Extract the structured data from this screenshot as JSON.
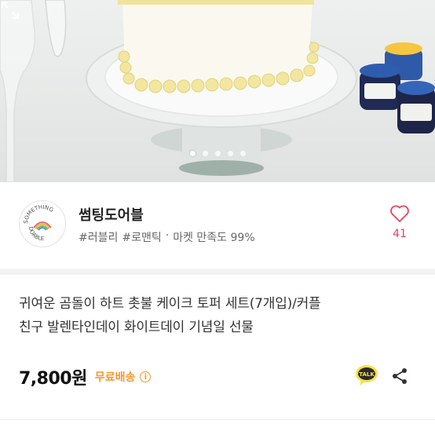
{
  "hero": {
    "slide_count": 5,
    "active_slide": 1
  },
  "seller": {
    "name": "썸팅도어블",
    "tags": [
      "#러블리",
      "#로맨틱"
    ],
    "separator": "·",
    "satisfaction": "마켓 만족도 99%",
    "likes": "41",
    "logo_text": "SOMETHING DOABLE"
  },
  "product": {
    "title_lines": [
      "귀여운 곰돌이 하트 촛불 케이크 토퍼 세트(7개입)/커플",
      "친구 발렌타인데이 화이트데이 기념일 선물"
    ],
    "price": "7,800원",
    "shipping": "무료배송",
    "info_glyph": "i"
  },
  "actions": {
    "talk_label": "TALK"
  },
  "colors": {
    "like": "#e9445d",
    "shipping": "#f2972f",
    "talk_bg": "#2b2b2b"
  }
}
